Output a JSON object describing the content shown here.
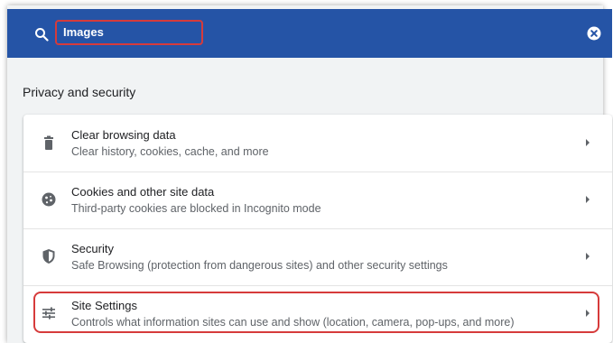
{
  "search": {
    "value": "Images"
  },
  "section": {
    "title": "Privacy and security"
  },
  "items": [
    {
      "title": "Clear browsing data",
      "description": "Clear history, cookies, cache, and more",
      "icon": "trash-icon"
    },
    {
      "title": "Cookies and other site data",
      "description": "Third-party cookies are blocked in Incognito mode",
      "icon": "cookie-icon"
    },
    {
      "title": "Security",
      "description": "Safe Browsing (protection from dangerous sites) and other security settings",
      "icon": "shield-icon"
    },
    {
      "title": "Site Settings",
      "description": "Controls what information sites can use and show (location, camera, pop-ups, and more)",
      "icon": "tune-icon"
    }
  ],
  "colors": {
    "header": "#2554a6",
    "highlight": "#d63b3b",
    "background": "#f1f3f4"
  }
}
